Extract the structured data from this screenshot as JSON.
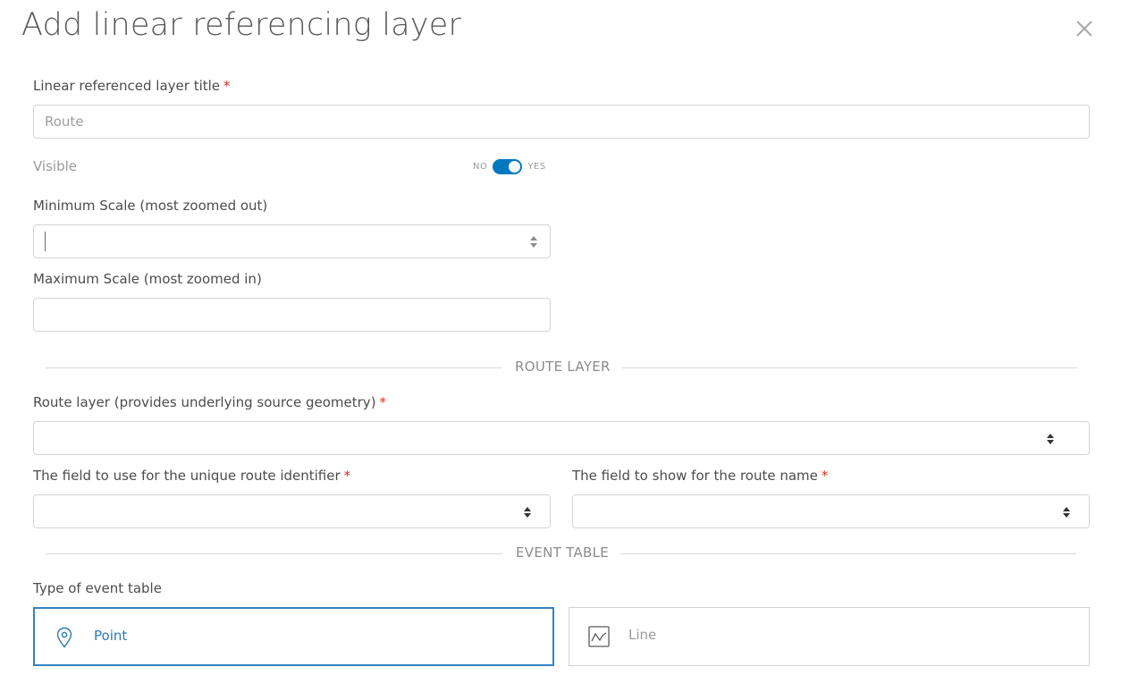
{
  "dialog": {
    "title": "Add linear referencing layer",
    "close_icon": "close-icon"
  },
  "fields": {
    "layer_title": {
      "label": "Linear referenced layer title",
      "required_mark": "*",
      "placeholder": "Route",
      "value": ""
    },
    "visible": {
      "label": "Visible",
      "off_label": "NO",
      "on_label": "YES",
      "state": true
    },
    "min_scale": {
      "label": "Minimum Scale (most zoomed out)",
      "value": ""
    },
    "max_scale": {
      "label": "Maximum Scale (most zoomed in)",
      "value": ""
    }
  },
  "route_section": {
    "title": "ROUTE LAYER",
    "route_layer": {
      "label": "Route layer (provides underlying source geometry)",
      "required_mark": "*",
      "value": ""
    },
    "route_id_field": {
      "label": "The field to use for the unique route identifier",
      "required_mark": "*",
      "value": ""
    },
    "route_name_field": {
      "label": "The field to show for the route name",
      "required_mark": "*",
      "value": ""
    }
  },
  "event_section": {
    "title": "EVENT TABLE",
    "type_label": "Type of event table",
    "options": [
      {
        "label": "Point",
        "icon": "map-pin-icon",
        "selected": true
      },
      {
        "label": "Line",
        "icon": "line-chart-icon",
        "selected": false
      }
    ]
  },
  "colors": {
    "accent": "#0079c1",
    "required": "#d83020",
    "selected_border": "#3284c2"
  }
}
